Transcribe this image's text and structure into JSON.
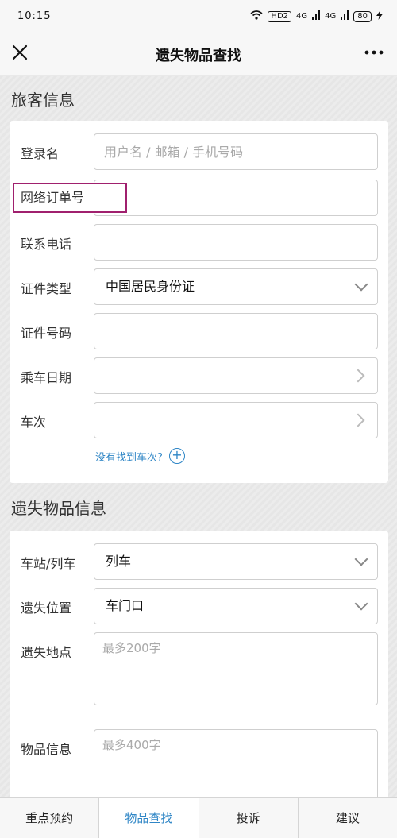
{
  "status": {
    "time": "10:15",
    "hd_badge": "HD2",
    "signal_1": "4G",
    "signal_2": "4G",
    "battery": "80"
  },
  "nav": {
    "title": "遗失物品查找"
  },
  "passenger": {
    "section_title": "旅客信息",
    "login_label": "登录名",
    "login_placeholder": "用户名 / 邮箱 / 手机号码",
    "order_label": "网络订单号",
    "order_value": "",
    "phone_label": "联系电话",
    "phone_value": "",
    "id_type_label": "证件类型",
    "id_type_value": "中国居民身份证",
    "id_number_label": "证件号码",
    "id_number_value": "",
    "date_label": "乘车日期",
    "train_label": "车次",
    "train_not_found_link": "没有找到车次?"
  },
  "item": {
    "section_title": "遗失物品信息",
    "station_label": "车站/列车",
    "station_value": "列车",
    "position_label": "遗失位置",
    "position_value": "车门口",
    "place_label": "遗失地点",
    "place_placeholder": "最多200字",
    "info_label": "物品信息",
    "info_placeholder": "最多400字"
  },
  "tabs": [
    {
      "label": "重点预约"
    },
    {
      "label": "物品查找"
    },
    {
      "label": "投诉"
    },
    {
      "label": "建议"
    }
  ],
  "colors": {
    "accent": "#2f86c6",
    "highlight": "#a0206e"
  }
}
